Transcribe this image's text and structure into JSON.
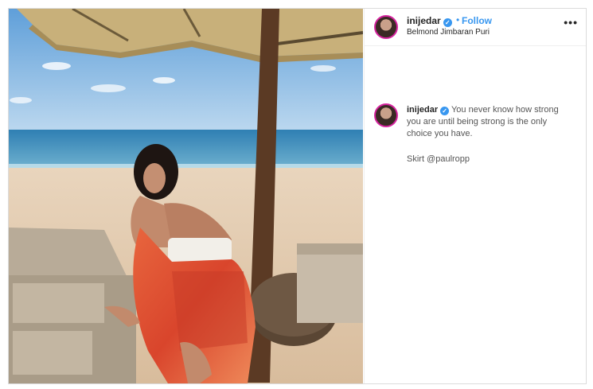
{
  "post": {
    "username": "inijedar",
    "verified": true,
    "follow_label": "Follow",
    "dot": "•",
    "location": "Belmond Jimbaran Puri",
    "more_label": "•••",
    "caption": "You never know how strong you are until being strong is the only choice you have.",
    "mention_line": "Skirt @paulropp"
  },
  "colors": {
    "link_blue": "#3897f0",
    "text": "#262626",
    "border": "#dbdbdb"
  },
  "icons": [
    "verified-badge-icon",
    "more-options-icon"
  ]
}
